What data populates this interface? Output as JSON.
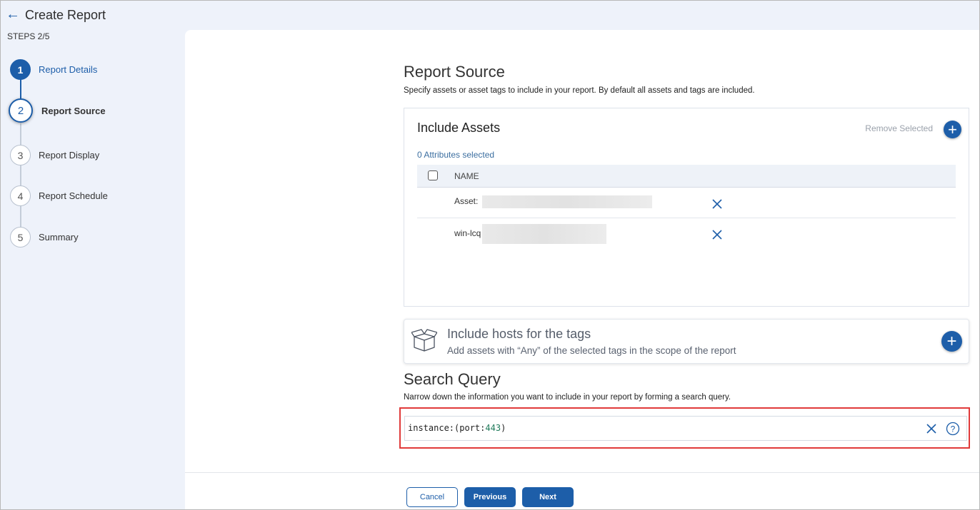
{
  "header": {
    "back_icon": "arrow-left-icon",
    "title": "Create Report",
    "steps_label": "STEPS 2/5"
  },
  "stepper": {
    "steps": [
      {
        "number": "1",
        "label": "Report Details",
        "state": "done"
      },
      {
        "number": "2",
        "label": "Report Source",
        "state": "active"
      },
      {
        "number": "3",
        "label": "Report Display",
        "state": "pending"
      },
      {
        "number": "4",
        "label": "Report Schedule",
        "state": "pending"
      },
      {
        "number": "5",
        "label": "Summary",
        "state": "pending"
      }
    ]
  },
  "report_source": {
    "title": "Report Source",
    "description": "Specify assets or asset tags to include in your report. By default all assets and tags are included."
  },
  "include_assets": {
    "title": "Include Assets",
    "remove_selected_label": "Remove Selected",
    "add_icon": "plus-icon",
    "attributes_selected": "0 Attributes selected",
    "column_name": "NAME",
    "rows": [
      {
        "name": "Asset: "
      },
      {
        "name": "win-lcq"
      }
    ]
  },
  "include_tags": {
    "icon": "open-box-icon",
    "title": "Include hosts for the tags",
    "subtitle": "Add assets with “Any” of the selected tags in the scope of the report",
    "add_icon": "plus-icon"
  },
  "search_query": {
    "title": "Search Query",
    "description": "Narrow down the information you want to include in your report by forming a search query.",
    "query_prefix": "instance:(port:",
    "query_number": "443",
    "query_suffix": ")",
    "clear_icon": "close-icon",
    "help_icon": "help-circle-icon"
  },
  "footer": {
    "cancel_label": "Cancel",
    "previous_label": "Previous",
    "next_label": "Next"
  },
  "colors": {
    "primary": "#1d5ea9",
    "highlight_border": "#e03a3a",
    "sidebar_bg": "#eef2fa"
  }
}
